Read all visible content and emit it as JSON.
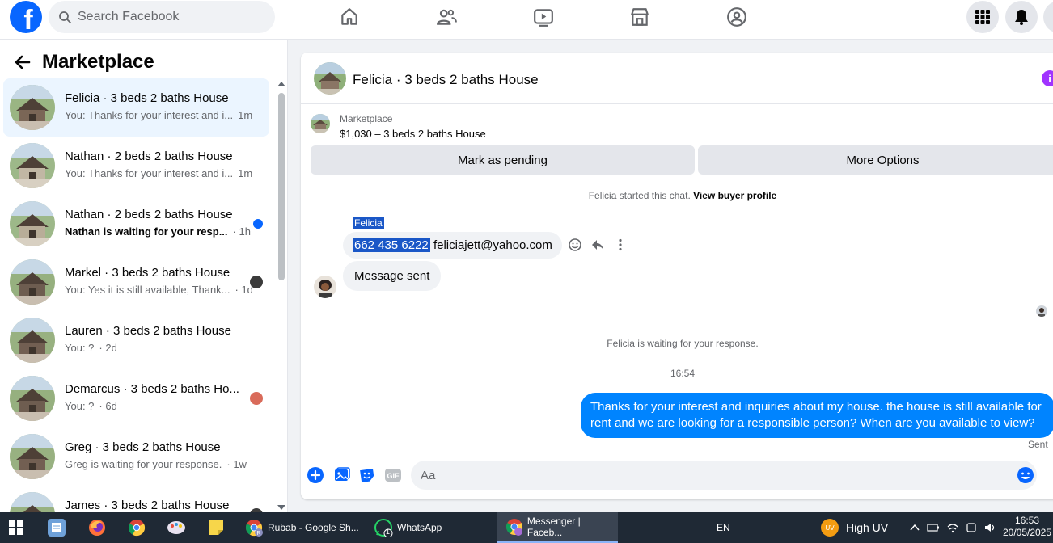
{
  "topbar": {
    "search_placeholder": "Search Facebook"
  },
  "left_panel": {
    "title": "Marketplace",
    "conversations": [
      {
        "title": "Felicia · 3 beds 2 baths House",
        "snippet": "You: Thanks for your interest and i...",
        "time": "1m",
        "active": true
      },
      {
        "title": "Nathan · 2 beds 2 baths House",
        "snippet": "You: Thanks for your interest and i...",
        "time": "1m"
      },
      {
        "title": "Nathan · 2 beds 2 baths House",
        "snippet": "Nathan is waiting for your resp...",
        "time": "· 1h",
        "unread": true
      },
      {
        "title": "Markel · 3 beds 2 baths House",
        "snippet": "You: Yes it is still available, Thank...",
        "time": "· 1d"
      },
      {
        "title": "Lauren · 3 beds 2 baths House",
        "snippet": "You: ?",
        "time": "· 2d"
      },
      {
        "title": "Demarcus · 3 beds 2 baths Ho...",
        "snippet": "You: ?",
        "time": "· 6d"
      },
      {
        "title": "Greg · 3 beds 2 baths House",
        "snippet": "Greg is waiting for your response.",
        "time": "· 1w"
      },
      {
        "title": "James · 3 beds 2 baths House",
        "snippet": "",
        "time": ""
      }
    ]
  },
  "chat": {
    "title": "Felicia · 3 beds 2 baths House",
    "listing_source": "Marketplace",
    "listing_title": "$1,030 – 3 beds 2 baths House",
    "mark_pending": "Mark as pending",
    "more_options": "More Options",
    "started_text": "Felicia started this chat.",
    "view_profile": "View buyer profile",
    "sender_name": "Felicia",
    "msg1_phone": "662 435 6222",
    "msg1_email": "feliciajett@yahoo.com",
    "msg2": "Message sent",
    "waiting": "Felicia is waiting for your response.",
    "timestamp": "16:54",
    "outgoing": "Thanks for your interest and inquiries about my house. the house is still available for rent and we are looking for a responsible person? When are you available to view?",
    "sent_label": "Sent",
    "composer_placeholder": "Aa"
  },
  "taskbar": {
    "items": [
      {
        "label": "Rubab - Google Sh..."
      },
      {
        "label": "WhatsApp"
      },
      {
        "label": "Messenger | Faceb..."
      }
    ],
    "lang": "EN",
    "weather": "High UV",
    "weather_badge": "UV",
    "whatsapp_badge": "1",
    "time": "16:53",
    "date": "20/05/2025"
  },
  "colors": {
    "fb_blue": "#0866ff",
    "messenger_blue": "#0084ff",
    "highlight": "#1a57c7",
    "taskbar": "#1f2935"
  }
}
